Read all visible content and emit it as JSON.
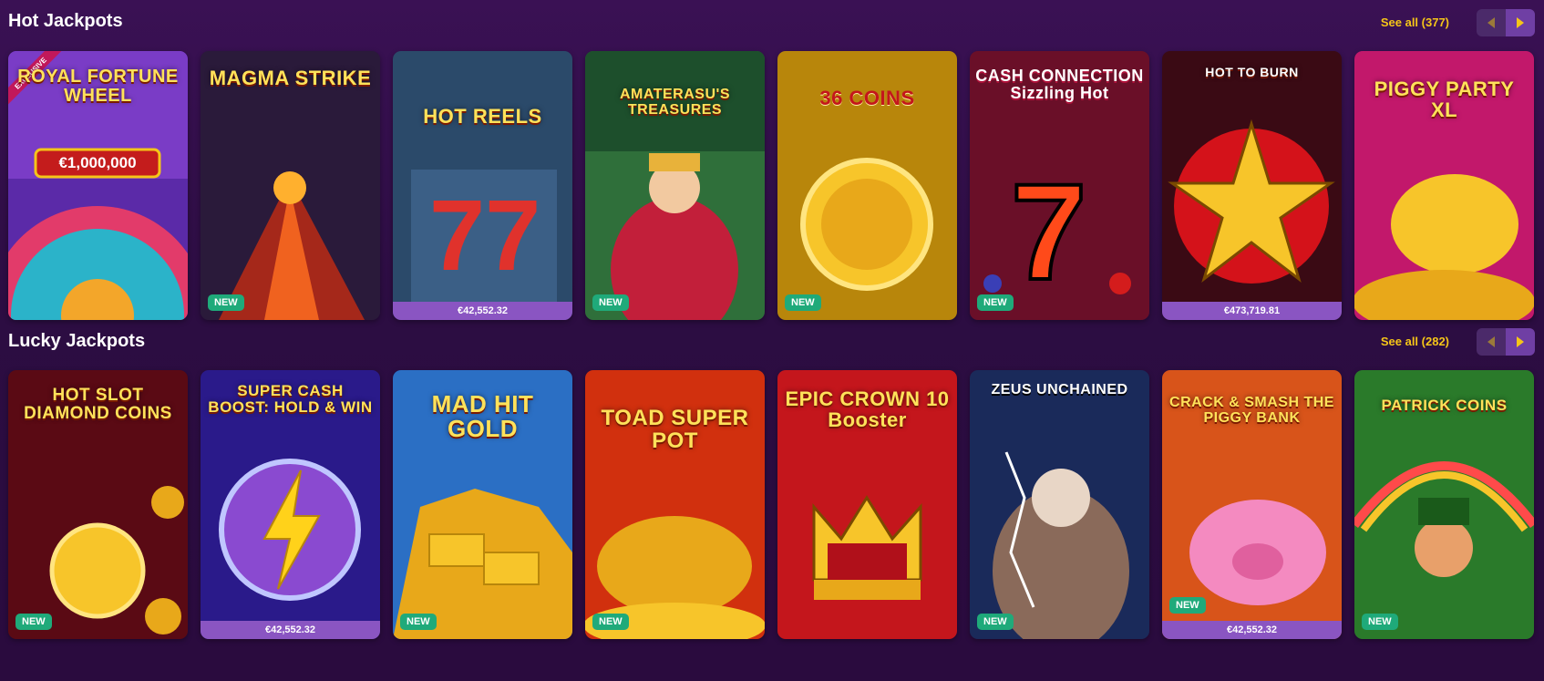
{
  "sections": [
    {
      "title": "Hot Jackpots",
      "see_all": "See all (377)",
      "games": [
        {
          "name": "ROYAL FORTUNE WHEEL",
          "badge": "EXCLUSIVE",
          "jackpot": "€1,000,000"
        },
        {
          "name": "MAGMA STRIKE",
          "badge": "NEW"
        },
        {
          "name": "HOT REELS",
          "jackpot": "€42,552.32"
        },
        {
          "name": "AMATERASU'S TREASURES",
          "badge": "NEW"
        },
        {
          "name": "36 COINS",
          "badge": "NEW"
        },
        {
          "name": "CASH CONNECTION Sizzling Hot",
          "badge": "NEW"
        },
        {
          "name": "HOT TO BURN",
          "jackpot": "€473,719.81"
        },
        {
          "name": "PIGGY PARTY XL"
        }
      ]
    },
    {
      "title": "Lucky Jackpots",
      "see_all": "See all (282)",
      "games": [
        {
          "name": "HOT SLOT DIAMOND COINS",
          "badge": "NEW"
        },
        {
          "name": "SUPER CASH BOOST: HOLD & WIN",
          "jackpot": "€42,552.32"
        },
        {
          "name": "MAD HIT GOLD",
          "badge": "NEW"
        },
        {
          "name": "TOAD SUPER POT",
          "badge": "NEW"
        },
        {
          "name": "EPIC CROWN 10 Booster"
        },
        {
          "name": "ZEUS UNCHAINED",
          "badge": "NEW"
        },
        {
          "name": "CRACK & SMASH THE PIGGY BANK",
          "badge": "NEW",
          "jackpot": "€42,552.32"
        },
        {
          "name": "PATRICK COINS",
          "badge": "NEW"
        }
      ]
    }
  ],
  "colors": {
    "accent": "#f5c518",
    "new_badge": "#1faa7a",
    "jackpot_bar": "#8a55c2",
    "background": "#2c0d42"
  },
  "icons": {
    "prev": "chevron-left-icon",
    "next": "chevron-right-icon"
  }
}
